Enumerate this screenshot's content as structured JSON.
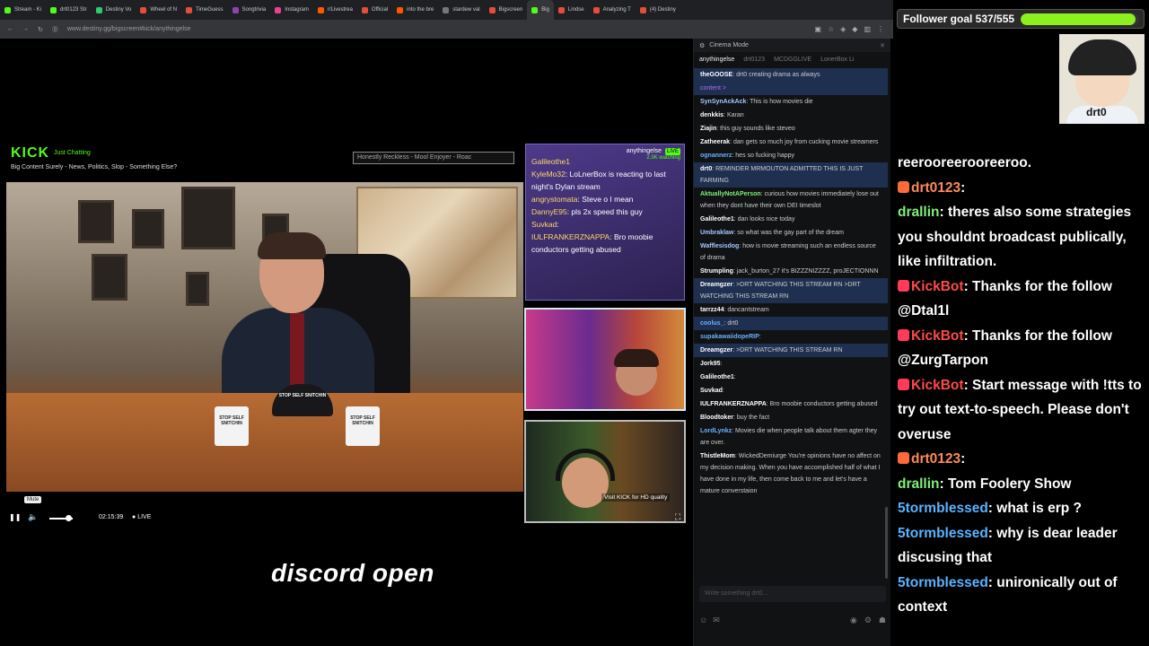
{
  "browser": {
    "tabs": [
      {
        "label": "Stream - Ki",
        "color": "#53fc18"
      },
      {
        "label": "drt0123 Str",
        "color": "#53fc18"
      },
      {
        "label": "Destiny Vo",
        "color": "#2ecc71"
      },
      {
        "label": "Wheel of N",
        "color": "#e74c3c"
      },
      {
        "label": "TimeGuess",
        "color": "#e74c3c"
      },
      {
        "label": "Songtrivia",
        "color": "#8e44ad"
      },
      {
        "label": "Instagram",
        "color": "#e84393"
      },
      {
        "label": "r/Livestrea",
        "color": "#ff5700"
      },
      {
        "label": "Official",
        "color": "#e74c3c"
      },
      {
        "label": "into the bre",
        "color": "#ff5700"
      },
      {
        "label": "stardew val",
        "color": "#777777"
      },
      {
        "label": "Bigscreen",
        "color": "#e74c3c"
      },
      {
        "label": "Big",
        "color": "#53fc18",
        "active": true
      },
      {
        "label": "Lindse",
        "color": "#e74c3c"
      },
      {
        "label": "Analyzing T",
        "color": "#e74c3c"
      },
      {
        "label": "(4) Destiny",
        "color": "#e74c3c"
      }
    ],
    "url": "www.destiny.gg/bigscreen#kick/anythingelse"
  },
  "stream": {
    "platform": "KICK",
    "category": "Just Chatting",
    "title": "Big Content Surely - News, Politics, Slop - Something Else?",
    "banner": "Honestly Reckless - Mool Enjoyer - Roac",
    "mug_text": "STOP SELF SNITCHIN",
    "cap_text": "STOP SELF SNITCHIN",
    "hd_notice": "Visit KICK for HD quality"
  },
  "overlay": {
    "channel": "anythingelse",
    "live_badge": "LIVE",
    "watching": "2.3K watching",
    "messages": [
      {
        "user": "Galileothe1",
        "text": ""
      },
      {
        "user": "KyleMo32",
        "text": ": LoLnerBox is reacting to last night's Dylan stream"
      },
      {
        "user": "angrystomata",
        "text": ": Steve o I mean"
      },
      {
        "user": "DannyE95",
        "text": ": pls 2x speed this guy"
      },
      {
        "user": "Suvkad",
        "text": ":"
      },
      {
        "user": "IULFRANKERZNAPPA",
        "text": ": Bro moobie conductors getting abused"
      }
    ]
  },
  "controls": {
    "tooltip": "Mute",
    "time": "02:15:39",
    "live": "LIVE",
    "volume_level": 0.8
  },
  "caption": "discord open",
  "chat": {
    "header": "Cinema Mode",
    "tabs": [
      "anythingelse",
      "drt0123",
      "MCDGGLIVE",
      "LonerBox Li"
    ],
    "messages": [
      {
        "user": "theGOOSE",
        "text": ": drt0 creating drama as always",
        "color": "#ffffff",
        "hl": true
      },
      {
        "user": "",
        "text": "content >",
        "color": "#a970ff",
        "hl": true
      },
      {
        "user": "SynSynAckAck",
        "text": ": This is how movies die",
        "color": "#a4c8ff"
      },
      {
        "user": "denkkis",
        "text": ": Karan",
        "color": "#ffffff"
      },
      {
        "user": "Ziajin",
        "text": ": this guy sounds like steveo",
        "color": "#ffffff"
      },
      {
        "user": "Zatheerak",
        "text": ": dan gets so much joy from cucking movie streamers",
        "color": "#ffffff"
      },
      {
        "user": "ognannerz",
        "text": ": hes so fucking happy",
        "color": "#6ab0ff"
      },
      {
        "user": "drt0",
        "text": ": REMINDER MRMOUTON ADMITTED THIS IS JUST FARMING",
        "color": "#ffffff",
        "hl": true
      },
      {
        "user": "AktuallyNotAPerson",
        "text": ": curious how movies immediately lose out when they dont have their own DEI timeslot",
        "color": "#7ef07a"
      },
      {
        "user": "Galileothe1",
        "text": ": dan looks nice today",
        "color": "#ffffff"
      },
      {
        "user": "Umbraklaw",
        "text": ": so what was the gay part of the dream",
        "color": "#a4c8ff"
      },
      {
        "user": "Wafflesisdog",
        "text": ": how is movie streaming such an endless source of drama",
        "color": "#a4c8ff"
      },
      {
        "user": "Strumpling",
        "text": ": jack_burton_27 it's BIZZZNIZZZZ, proJECTIONNN",
        "color": "#ffffff"
      },
      {
        "user": "Dreamgzer",
        "text": ": >DRT WATCHING THIS STREAM RN >DRT WATCHING THIS STREAM RN",
        "color": "#ffffff",
        "hl": true
      },
      {
        "user": "tarrzz44",
        "text": ": dancantstream",
        "color": "#ffffff"
      },
      {
        "user": "coolus_",
        "text": ": drt0",
        "color": "#6ab0ff",
        "hl": true
      },
      {
        "user": "supakawaiidopeRIP",
        "text": ":",
        "color": "#6ab0ff"
      },
      {
        "user": "Dreamgzer",
        "text": ": >DRT WATCHING THIS STREAM RN",
        "color": "#ffffff",
        "hl": true
      },
      {
        "user": "Jork95",
        "text": ":",
        "color": "#ffffff"
      },
      {
        "user": "Galileothe1",
        "text": ":",
        "color": "#ffffff"
      },
      {
        "user": "Suvkad",
        "text": ":",
        "color": "#ffffff"
      },
      {
        "user": "IULFRANKERZNAPPA",
        "text": ": Bro moobie conductors getting abused",
        "color": "#ffffff"
      },
      {
        "user": "Bloodtoker",
        "text": ": buy the fact",
        "color": "#ffffff"
      },
      {
        "user": "LordLynkz",
        "text": ": Movies die when people talk about them agter they are over.",
        "color": "#6ab0ff"
      },
      {
        "user": "ThistleMom",
        "text": ": WickedDemiurge You're opinions have no affect on my decision making. When you have accomplished half of what I have done in my life, then come back to me and let's have a mature converstaion",
        "color": "#ffffff"
      }
    ],
    "input_placeholder": "Write something drt0..."
  },
  "goal": {
    "label": "Follower goal 537/555",
    "progress": 0.9676
  },
  "avatar": {
    "label": "drt0"
  },
  "right_chat": [
    {
      "user": "",
      "text": "reerooreerooreeroo.",
      "color": "g"
    },
    {
      "user": "drt0123",
      "text": ":",
      "color": "o"
    },
    {
      "user": "drallin",
      "text": ":  theres also some strategies you shouldnt broadcast publically, like infiltration.",
      "color": "g"
    },
    {
      "user": "KickBot",
      "text": ":  Thanks for the follow @Dtal1l",
      "color": "r"
    },
    {
      "user": "KickBot",
      "text": ":  Thanks for the follow @ZurgTarpon",
      "color": "r"
    },
    {
      "user": "KickBot",
      "text": ":  Start message with !tts to try out text-to-speech. Please don't overuse",
      "color": "r"
    },
    {
      "user": "drt0123",
      "text": ":",
      "color": "o"
    },
    {
      "user": "drallin",
      "text": ":  Tom Foolery Show",
      "color": "g"
    },
    {
      "user": "5tormblessed",
      "text": ":  what is erp ?",
      "color": "b"
    },
    {
      "user": "5tormblessed",
      "text": ":  why is dear leader discusing that",
      "color": "b"
    },
    {
      "user": "5tormblessed",
      "text": ":  unironically out of context",
      "color": "b"
    }
  ]
}
